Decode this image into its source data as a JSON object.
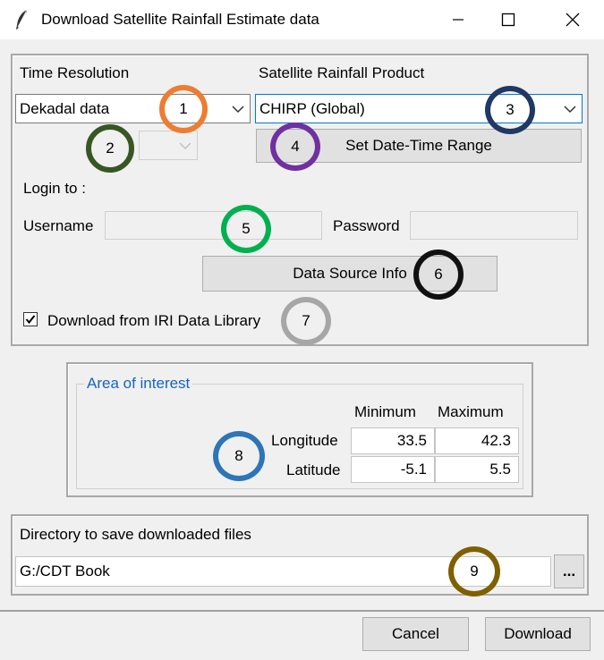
{
  "window": {
    "title": "Download Satellite Rainfall Estimate data",
    "icon": "feather-icon",
    "controls": [
      "minimize-icon",
      "maximize-icon",
      "close-icon"
    ]
  },
  "time_resolution": {
    "label": "Time Resolution",
    "selected": "Dekadal data"
  },
  "product": {
    "label": "Satellite Rainfall Product",
    "selected": "CHIRP (Global)"
  },
  "sub_combo": {
    "selected": ""
  },
  "date_range_button": "Set Date-Time Range",
  "login": {
    "heading": "Login to :",
    "username_label": "Username",
    "username_value": "",
    "password_label": "Password",
    "password_value": ""
  },
  "data_source_button": "Data Source Info",
  "iri_checkbox": {
    "label": "Download from IRI Data Library",
    "checked": true
  },
  "area": {
    "title": "Area of interest",
    "col_min": "Minimum",
    "col_max": "Maximum",
    "rows": [
      {
        "label": "Longitude",
        "min": "33.5",
        "max": "42.3"
      },
      {
        "label": "Latitude",
        "min": "-5.1",
        "max": "5.5"
      }
    ]
  },
  "directory": {
    "label": "Directory to save downloaded files",
    "value": "G:/CDT Book",
    "browse": "..."
  },
  "footer": {
    "cancel": "Cancel",
    "download": "Download"
  },
  "markers": [
    {
      "n": "1",
      "color": "#ed7d31"
    },
    {
      "n": "2",
      "color": "#375623"
    },
    {
      "n": "3",
      "color": "#1f3864"
    },
    {
      "n": "4",
      "color": "#7030a0"
    },
    {
      "n": "5",
      "color": "#00b050"
    },
    {
      "n": "6",
      "color": "#111111"
    },
    {
      "n": "7",
      "color": "#a6a6a6"
    },
    {
      "n": "8",
      "color": "#2e75b6"
    },
    {
      "n": "9",
      "color": "#7f6000"
    }
  ]
}
